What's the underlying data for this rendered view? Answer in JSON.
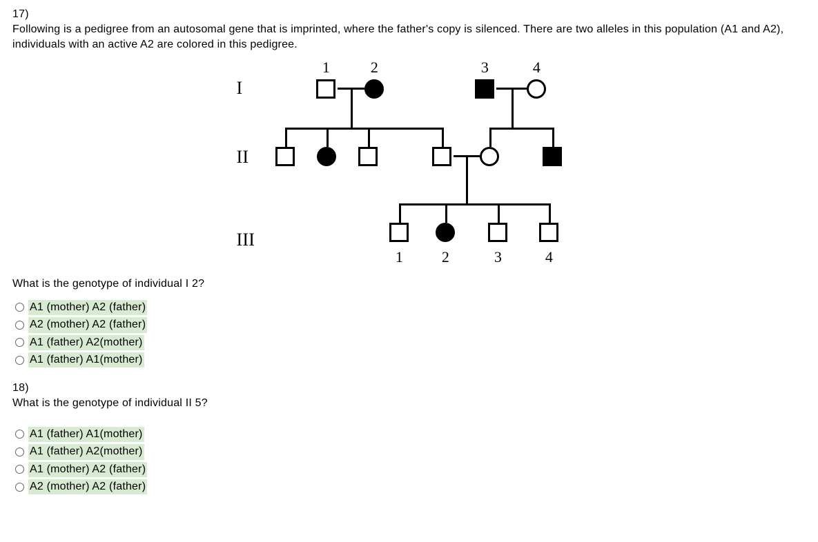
{
  "q17": {
    "num": "17)",
    "text": "Following is a pedigree from an autosomal gene that is imprinted, where the father's copy is silenced. There are two alleles in this population (A1 and A2), individuals with an active A2 are colored in this pedigree.",
    "prompt": "What is the genotype of individual I 2?",
    "options": [
      "A1 (mother) A2 (father)",
      "A2 (mother) A2 (father)",
      "A1 (father) A2(mother)",
      "A1 (father) A1(mother)"
    ]
  },
  "q18": {
    "num": "18)",
    "prompt": "What is the genotype of individual II 5?",
    "options": [
      "A1 (father) A1(mother)",
      "A1 (father) A2(mother)",
      "A1 (mother) A2 (father)",
      "A2 (mother) A2 (father)"
    ]
  },
  "pedigree": {
    "gen_labels": [
      "I",
      "II",
      "III"
    ],
    "top_nums": [
      "1",
      "2",
      "3",
      "4"
    ],
    "bottom_nums": [
      "1",
      "2",
      "3",
      "4"
    ]
  }
}
